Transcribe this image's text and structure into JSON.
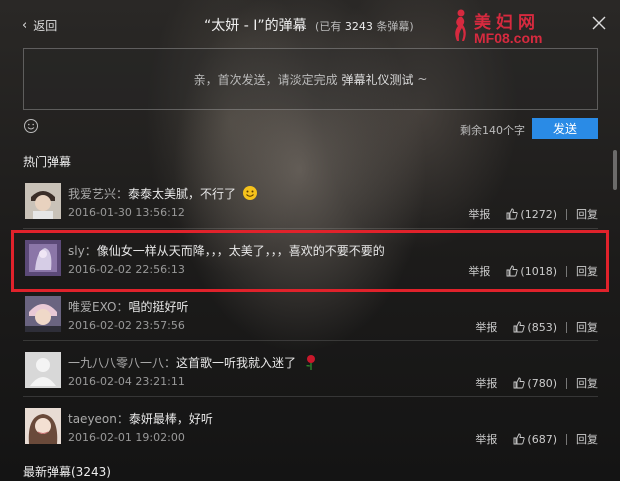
{
  "header": {
    "back_label": "返回",
    "title": "“太妍 - I”的弹幕",
    "count_prefix": "(已有",
    "count_value": "3243",
    "count_suffix": "条弹幕)"
  },
  "watermark": {
    "cn": "美妇网",
    "en": "MF08.com"
  },
  "composer": {
    "placeholder_prefix": "亲，首次发送，请淡定完成",
    "placeholder_highlight": "弹幕礼仪测试",
    "placeholder_suffix": "~",
    "remaining": "剩余140个字",
    "send_label": "发送"
  },
  "hot_section": {
    "title": "热门弹幕"
  },
  "latest_section": {
    "title": "最新弹幕(3243)"
  },
  "actions": {
    "report_label": "举报",
    "reply_label": "回复"
  },
  "comments": [
    {
      "user": "我爱艺兴",
      "text": "泰泰太美腻，不行了",
      "has_emoji": true,
      "date": "2016-01-30 13:56:12",
      "likes": "(1272)",
      "avatar": "avatar-boy"
    },
    {
      "user": "sly",
      "text": "像仙女一样从天而降，，，太美了，，，喜欢的不要不要的",
      "has_emoji": false,
      "date": "2016-02-02 22:56:13",
      "likes": "(1018)",
      "avatar": "avatar-purple"
    },
    {
      "user": "唯爱EXO",
      "text": "唱的挺好听",
      "has_emoji": false,
      "date": "2016-02-02 23:57:56",
      "likes": "(853)",
      "avatar": "avatar-pink"
    },
    {
      "user": "一九八八零八一八",
      "text": "这首歌一听我就入迷了",
      "has_emoji": true,
      "date": "2016-02-04 23:21:11",
      "likes": "(780)",
      "avatar": "avatar-default"
    },
    {
      "user": "taeyeon",
      "text": "泰妍最棒，好听",
      "has_emoji": false,
      "date": "2016-02-01 19:02:00",
      "likes": "(687)",
      "avatar": "avatar-girl"
    }
  ],
  "colors": {
    "accent": "#2a8be6",
    "highlight": "#e0222b",
    "watermark": "#d62a3f"
  }
}
